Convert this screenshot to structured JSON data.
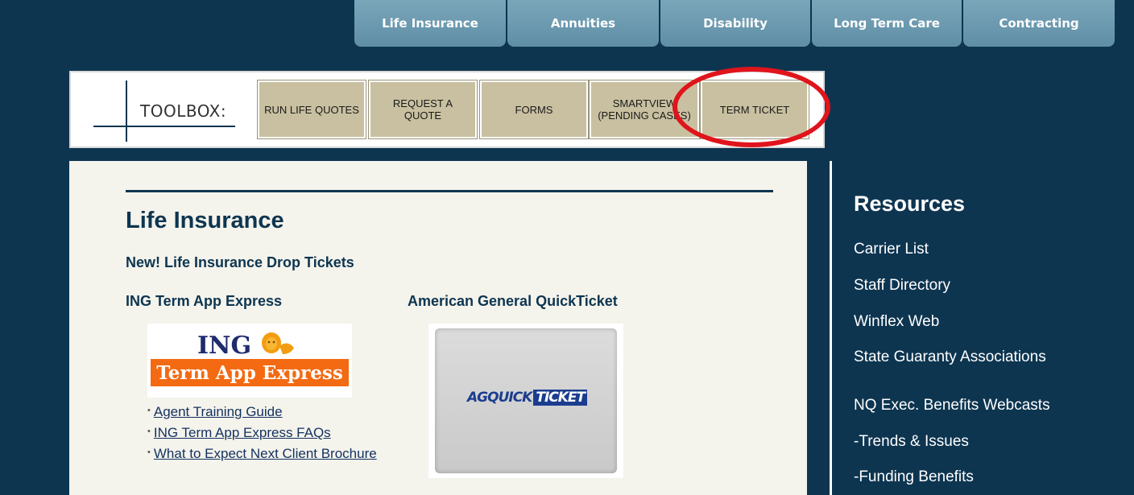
{
  "nav": {
    "tabs": [
      {
        "label": "Life Insurance"
      },
      {
        "label": "Annuities"
      },
      {
        "label": "Disability"
      },
      {
        "label": "Long Term Care"
      },
      {
        "label": "Contracting"
      }
    ]
  },
  "toolbox": {
    "label": "TOOLBOX:",
    "buttons": [
      {
        "label": "RUN LIFE QUOTES"
      },
      {
        "label": "REQUEST A QUOTE"
      },
      {
        "label": "FORMS"
      },
      {
        "label": "SMARTVIEW (PENDING CASES)"
      },
      {
        "label": "TERM TICKET"
      }
    ]
  },
  "main": {
    "title": "Life Insurance",
    "subtitle": "New! Life Insurance Drop Tickets",
    "ing": {
      "heading": "ING Term App Express",
      "logo_word": "ING",
      "logo_bar": "Term App Express",
      "links": [
        {
          "label": "Agent Training Guide"
        },
        {
          "label": "ING Term App Express FAQs"
        },
        {
          "label": "What to Expect Next Client Brochure"
        }
      ]
    },
    "ag": {
      "heading": "American General QuickTicket",
      "logo_ag": "AG",
      "logo_quick": "QUICK",
      "logo_ticket": "TICKET"
    }
  },
  "resources": {
    "title": "Resources",
    "items": [
      {
        "label": "Carrier List"
      },
      {
        "label": "Staff Directory"
      },
      {
        "label": "Winflex Web"
      },
      {
        "label": "State Guaranty Associations"
      },
      {
        "label": "NQ Exec. Benefits Webcasts"
      },
      {
        "label": "-Trends & Issues"
      },
      {
        "label": "-Funding Benefits"
      }
    ]
  },
  "colors": {
    "background": "#0d3550",
    "tab": "#6b98ad",
    "toolbox_button": "#c8c0a0",
    "highlight_circle": "#e0141b",
    "content_bg": "#f4f3ec",
    "ing_orange": "#f36a12"
  }
}
